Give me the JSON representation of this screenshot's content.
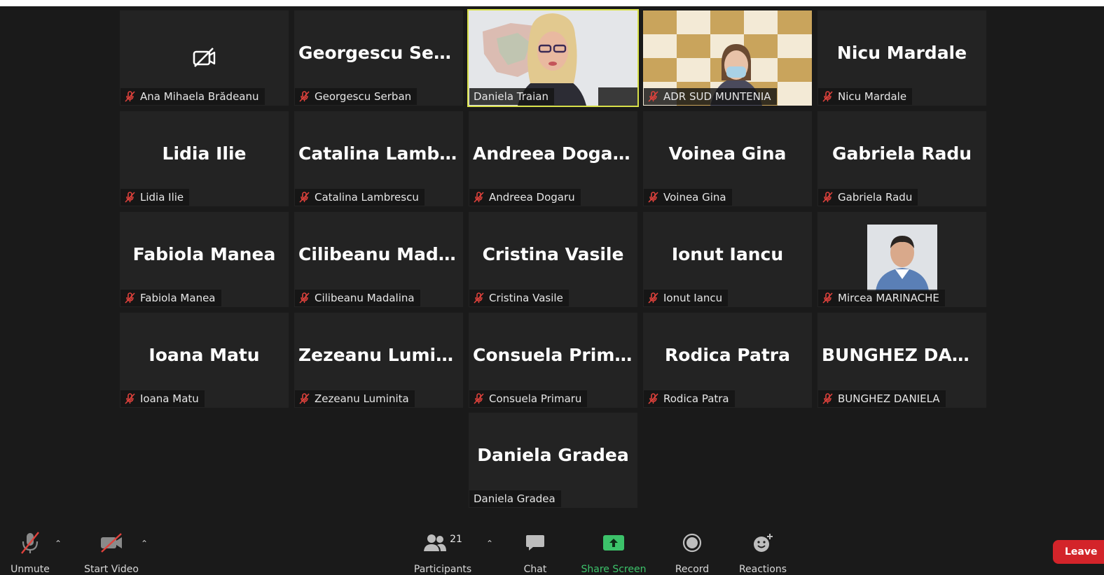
{
  "meeting": {
    "tiles": [
      {
        "display": "",
        "label": "Ana Mihaela Brădeanu",
        "muted": true,
        "video_off_icon": true
      },
      {
        "display": "Georgescu  Serb...",
        "label": "Georgescu Serban",
        "muted": true
      },
      {
        "display": "",
        "label": "Daniela Traian",
        "muted": false,
        "active_speaker": true,
        "video": "speaker-video"
      },
      {
        "display": "",
        "label": "ADR SUD MUNTENIA",
        "muted": true,
        "video": "adr-video"
      },
      {
        "display": "Nicu Mardale",
        "label": "Nicu Mardale",
        "muted": true
      },
      {
        "display": "Lidia Ilie",
        "label": "Lidia Ilie",
        "muted": true
      },
      {
        "display": "Catalina  Lambr...",
        "label": "Catalina Lambrescu",
        "muted": true
      },
      {
        "display": "Andreea Dogaru",
        "label": "Andreea Dogaru",
        "muted": true
      },
      {
        "display": "Voinea Gina",
        "label": "Voinea Gina",
        "muted": true
      },
      {
        "display": "Gabriela Radu",
        "label": "Gabriela Radu",
        "muted": true
      },
      {
        "display": "Fabiola Manea",
        "label": "Fabiola Manea",
        "muted": true
      },
      {
        "display": "Cilibeanu  Mada...",
        "label": "Cilibeanu Madalina",
        "muted": true
      },
      {
        "display": "Cristina Vasile",
        "label": "Cristina Vasile",
        "muted": true
      },
      {
        "display": "Ionut Iancu",
        "label": "Ionut Iancu",
        "muted": true
      },
      {
        "display": "",
        "label": "Mircea MARINACHE",
        "muted": true,
        "video": "profile-photo"
      },
      {
        "display": "Ioana Matu",
        "label": "Ioana Matu",
        "muted": true
      },
      {
        "display": "Zezeanu Luminita",
        "label": "Zezeanu Luminita",
        "muted": true
      },
      {
        "display": "Consuela Primaru",
        "label": "Consuela Primaru",
        "muted": true
      },
      {
        "display": "Rodica Patra",
        "label": "Rodica Patra",
        "muted": true
      },
      {
        "display": "BUNGHEZ  DAN...",
        "label": "BUNGHEZ DANIELA",
        "muted": true
      },
      {
        "display": "Daniela Gradea",
        "label": "Daniela Gradea",
        "muted": false
      }
    ]
  },
  "toolbar": {
    "unmute_label": "Unmute",
    "start_video_label": "Start Video",
    "participants_label": "Participants",
    "participants_count": "21",
    "chat_label": "Chat",
    "share_screen_label": "Share Screen",
    "record_label": "Record",
    "reactions_label": "Reactions",
    "leave_label": "Leave"
  },
  "colors": {
    "background": "#1a1a1a",
    "tile": "#232323",
    "active_speaker_border": "#d8e04a",
    "mute_red": "#e0423c",
    "share_green": "#3cc26a",
    "leave_red": "#d3242a"
  }
}
